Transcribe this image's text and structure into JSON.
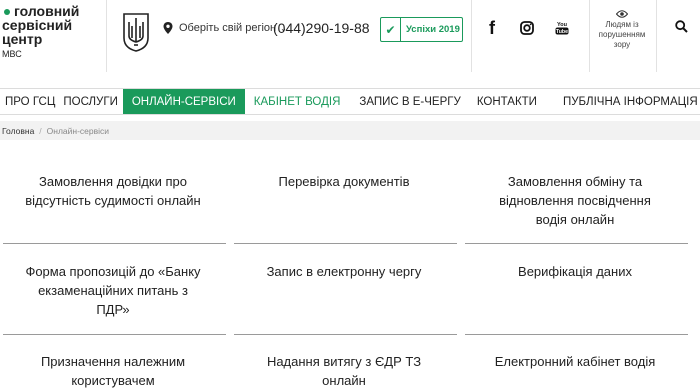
{
  "header": {
    "logo_lines": [
      "головний",
      "сервісний",
      "центр"
    ],
    "logo_sub": "МВС",
    "region_label": "Оберіть свій регіон",
    "phone": "(044)290-19-88",
    "success_label": "Успіхи 2019",
    "accessibility_label": "Людям із порушенням зору"
  },
  "nav": {
    "items": [
      {
        "label": "ПРО ГСЦ"
      },
      {
        "label": "ПОСЛУГИ"
      },
      {
        "label": "ОНЛАЙН-СЕРВІСИ"
      },
      {
        "label": "КАБІНЕТ ВОДІЯ"
      },
      {
        "label": "ЗАПИС В Е-ЧЕРГУ"
      },
      {
        "label": "КОНТАКТИ"
      },
      {
        "label": "ПУБЛІЧНА ІНФОРМАЦІЯ"
      }
    ]
  },
  "breadcrumb": {
    "home": "Головна",
    "separator": "/",
    "current": "Онлайн-сервіси"
  },
  "services": [
    {
      "lines": [
        "Замовлення довідки про",
        "відсутність судимості онлайн"
      ]
    },
    {
      "lines": [
        "Перевірка документів"
      ]
    },
    {
      "lines": [
        "Замовлення обміну та",
        "відновлення посвідчення",
        "водія онлайн"
      ]
    },
    {
      "lines": [
        "Форма пропозицій до «Банку",
        "екзаменаційних питань з",
        "ПДР»"
      ]
    },
    {
      "lines": [
        "Запис в електронну чергу"
      ]
    },
    {
      "lines": [
        "Верифікація даних"
      ]
    },
    {
      "lines": [
        "Призначення належним",
        "користувачем"
      ]
    },
    {
      "lines": [
        "Надання витягу з ЄДР ТЗ",
        "онлайн"
      ]
    },
    {
      "lines": [
        "Електронний кабінет водія"
      ]
    }
  ],
  "colors": {
    "accent": "#1a9a5b"
  }
}
